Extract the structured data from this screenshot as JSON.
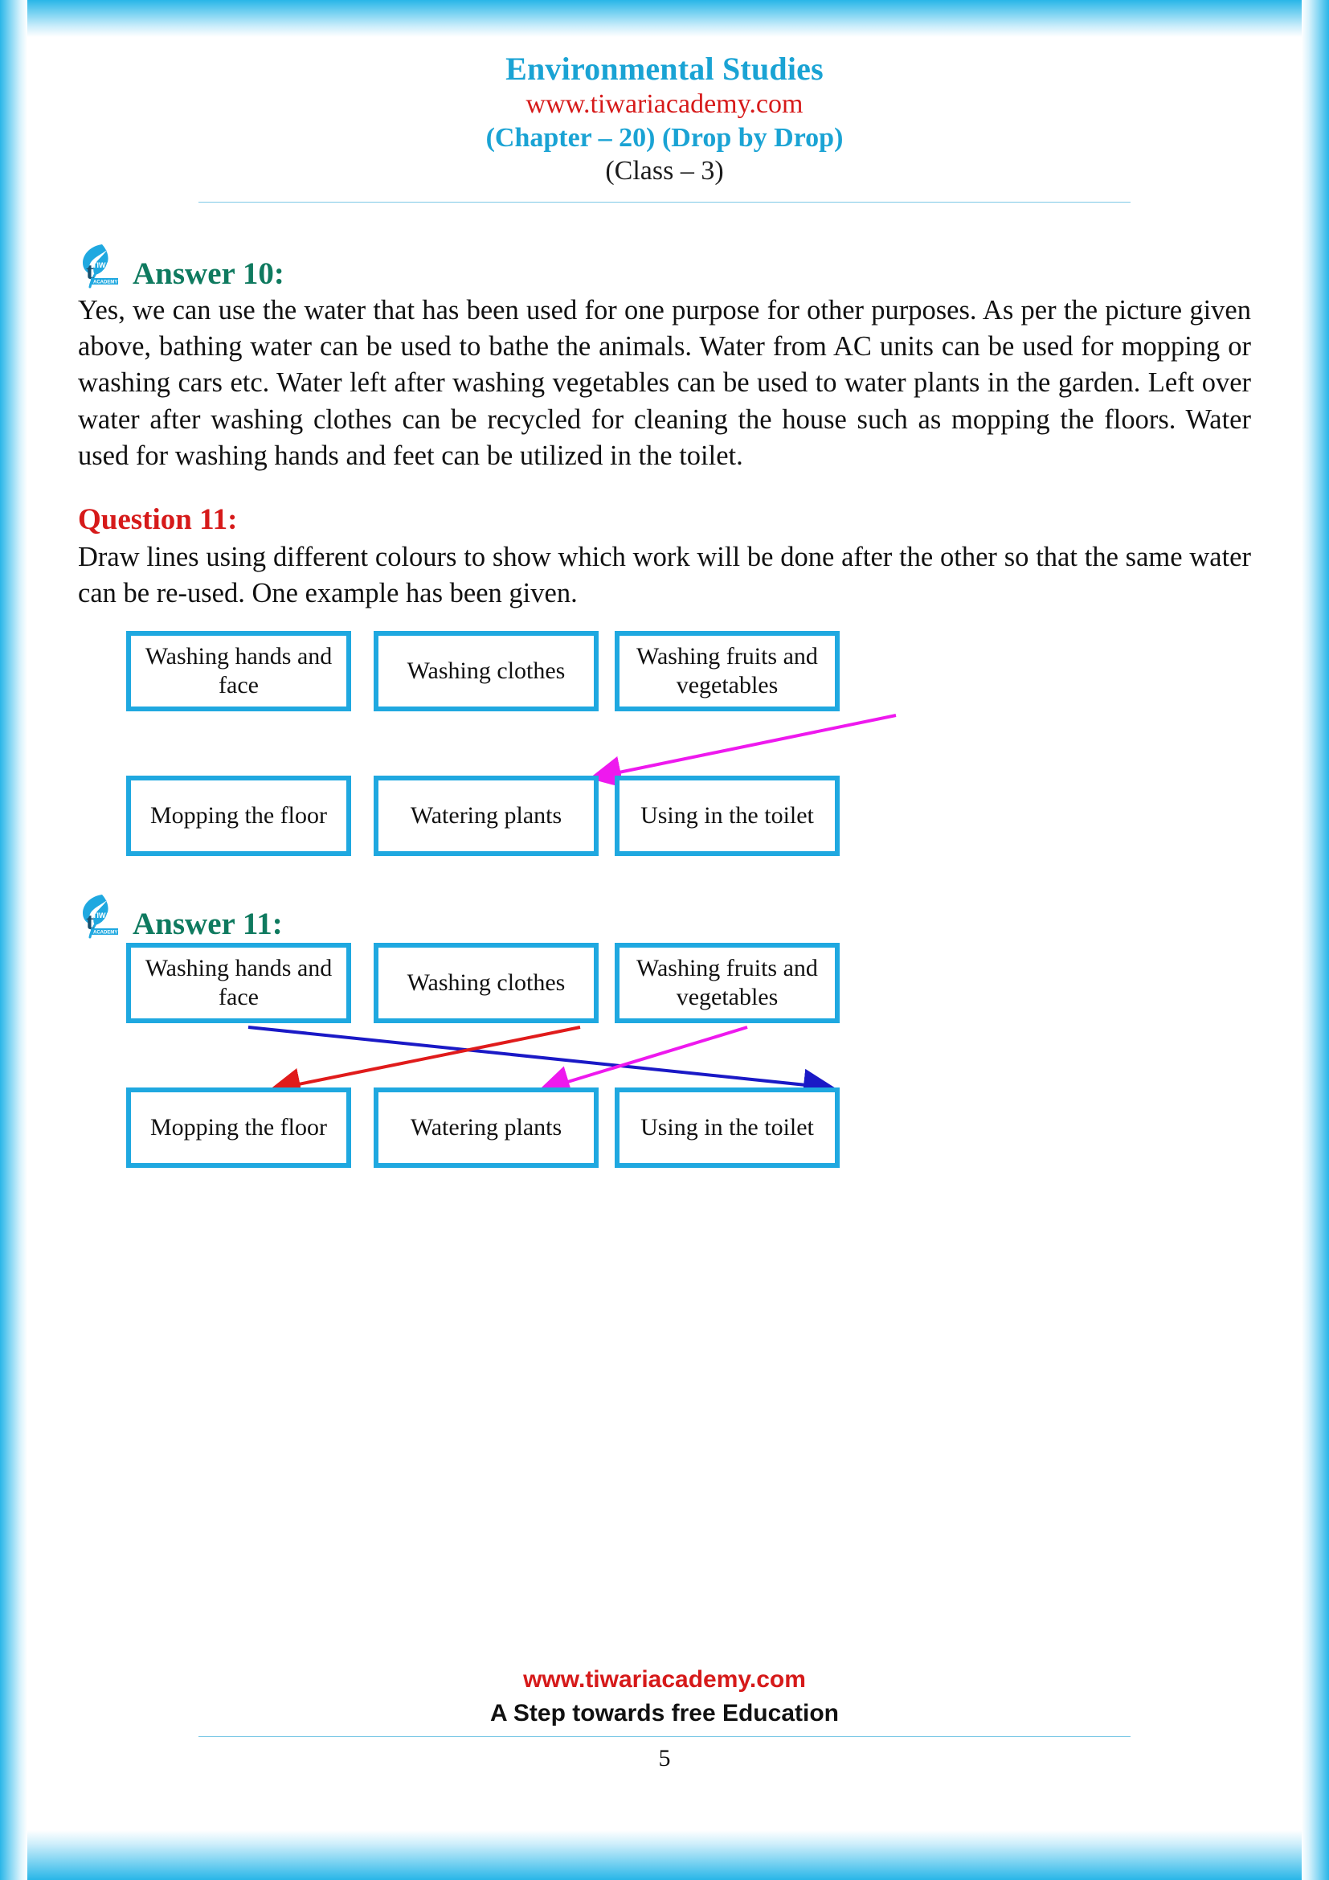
{
  "page": {
    "header": {
      "title": "Environmental Studies",
      "website": "www.tiwariacademy.com",
      "chapter": "(Chapter – 20) (Drop by Drop)",
      "class": "(Class – 3)"
    },
    "answer10": {
      "label": "Answer 10:",
      "text": "Yes, we can use the water that has been used for one purpose for other purposes. As per the picture given above, bathing water can be used to bathe the animals. Water from AC units can be used for mopping or washing cars etc. Water left after washing vegetables can be used to water plants in the garden. Left over water after washing clothes can be recycled for cleaning the house such as mopping the floors. Water used for washing hands and feet can be utilized in the toilet."
    },
    "question11": {
      "label": "Question 11:",
      "text": "Draw lines using different colours to show which work will be done after the other so that the same water can be re-used. One example has been given."
    },
    "answer11": {
      "label": "Answer 11:"
    },
    "diagram_question": {
      "top_row": [
        "Washing hands and face",
        "Washing clothes",
        "Washing fruits and vegetables"
      ],
      "bottom_row": [
        "Mopping the floor",
        "Watering plants",
        "Using in the toilet"
      ],
      "arrows": [
        {
          "from": "Washing fruits and vegetables",
          "to": "Watering plants",
          "color": "#ee19ee"
        }
      ]
    },
    "diagram_answer": {
      "top_row": [
        "Washing hands and face",
        "Washing clothes",
        "Washing fruits and vegetables"
      ],
      "bottom_row": [
        "Mopping the floor",
        "Watering plants",
        "Using in the toilet"
      ],
      "arrows": [
        {
          "from": "Washing hands and face",
          "to": "Using in the toilet",
          "color": "#1a19c6"
        },
        {
          "from": "Washing clothes",
          "to": "Mopping the floor",
          "color": "#e01b1b"
        },
        {
          "from": "Washing fruits and vegetables",
          "to": "Watering plants",
          "color": "#ee19ee"
        }
      ]
    },
    "footer": {
      "website": "www.tiwariacademy.com",
      "tagline": "A Step towards free Education",
      "page_number": "5"
    },
    "logo": {
      "letter": "t",
      "brand": "TIWARI",
      "sub": "ACADEMY"
    },
    "colors": {
      "accent_blue": "#1aa3d4",
      "brand_red": "#d61a1a",
      "answer_green": "#0f7a5f",
      "box_border": "#1fa8e0",
      "arrow_magenta": "#ee19ee",
      "arrow_blue": "#1a19c6",
      "arrow_red": "#e01b1b"
    }
  }
}
